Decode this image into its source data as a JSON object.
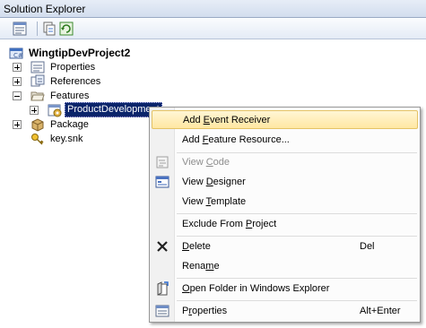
{
  "window": {
    "title": "Solution Explorer"
  },
  "toolbar": {
    "buttons": [
      {
        "icon": "properties-icon"
      },
      {
        "icon": "show-all-files-icon"
      },
      {
        "icon": "refresh-icon"
      }
    ]
  },
  "tree": {
    "project": "WingtipDevProject2",
    "items": [
      {
        "label": "Properties",
        "expander": "plus",
        "icon": "properties-folder-icon"
      },
      {
        "label": "References",
        "expander": "plus",
        "icon": "references-icon"
      },
      {
        "label": "Features",
        "expander": "minus",
        "icon": "folder-open-icon"
      },
      {
        "label": "ProductDevelopment",
        "expander": "plus",
        "icon": "feature-icon",
        "selected": true
      },
      {
        "label": "Package",
        "expander": "plus",
        "icon": "package-icon"
      },
      {
        "label": "key.snk",
        "expander": null,
        "icon": "key-icon"
      }
    ]
  },
  "context_menu": {
    "items": [
      {
        "pre": "Add ",
        "u": "E",
        "post": "vent Receiver",
        "shortcut": "",
        "icon": "",
        "highlighted": true,
        "enabled": true
      },
      {
        "pre": "Add ",
        "u": "F",
        "post": "eature Resource...",
        "shortcut": "",
        "icon": "",
        "enabled": true
      },
      {
        "pre": "View ",
        "u": "C",
        "post": "ode",
        "shortcut": "",
        "icon": "view-code-icon",
        "enabled": false
      },
      {
        "pre": "View ",
        "u": "D",
        "post": "esigner",
        "shortcut": "",
        "icon": "view-designer-icon",
        "enabled": true
      },
      {
        "pre": "View ",
        "u": "T",
        "post": "emplate",
        "shortcut": "",
        "icon": "",
        "enabled": true
      },
      {
        "pre": "Exclude From ",
        "u": "P",
        "post": "roject",
        "shortcut": "",
        "icon": "",
        "enabled": true
      },
      {
        "pre": "",
        "u": "D",
        "post": "elete",
        "shortcut": "Del",
        "icon": "delete-icon",
        "enabled": true
      },
      {
        "pre": "Rena",
        "u": "m",
        "post": "e",
        "shortcut": "",
        "icon": "",
        "enabled": true
      },
      {
        "pre": "",
        "u": "O",
        "post": "pen Folder in Windows Explorer",
        "shortcut": "",
        "icon": "open-folder-icon",
        "enabled": true
      },
      {
        "pre": "P",
        "u": "r",
        "post": "operties",
        "shortcut": "Alt+Enter",
        "icon": "properties-icon",
        "enabled": true
      }
    ]
  }
}
